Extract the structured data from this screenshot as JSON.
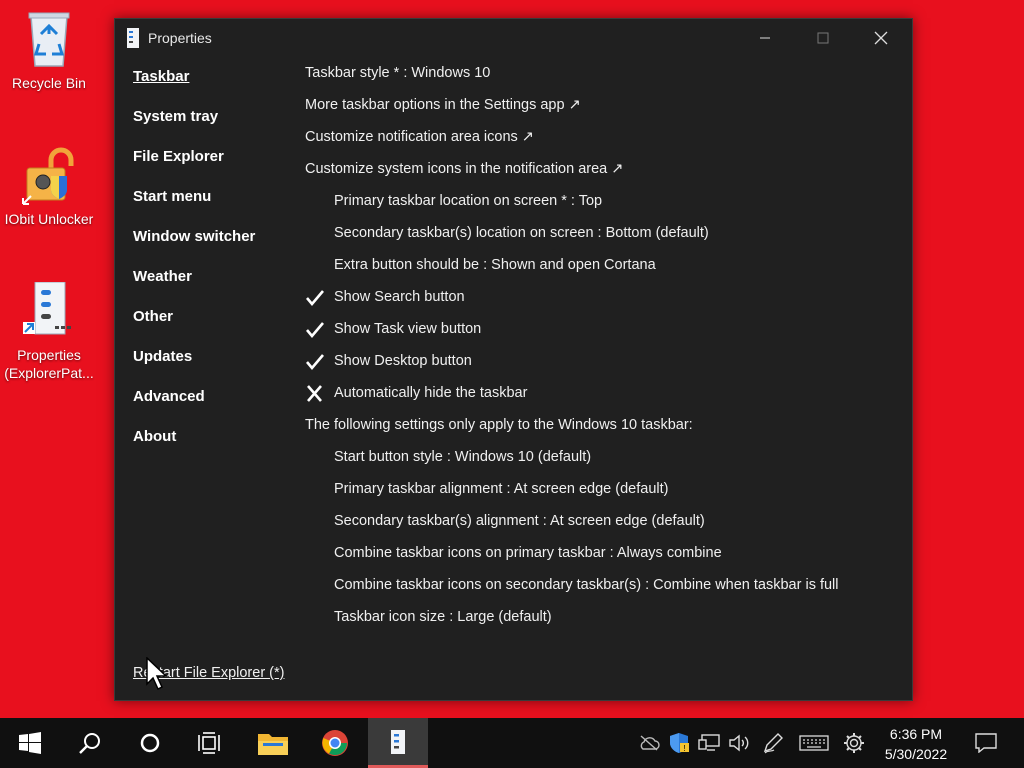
{
  "desktop": {
    "icons": [
      {
        "label": "Recycle Bin"
      },
      {
        "label": "IObit Unlocker"
      },
      {
        "label": "Properties (ExplorerPat..."
      }
    ]
  },
  "window": {
    "title": "Properties",
    "sidebar": [
      {
        "label": "Taskbar",
        "active": true
      },
      {
        "label": "System tray"
      },
      {
        "label": "File Explorer"
      },
      {
        "label": "Start menu"
      },
      {
        "label": "Window switcher"
      },
      {
        "label": "Weather"
      },
      {
        "label": "Other"
      },
      {
        "label": "Updates"
      },
      {
        "label": "Advanced"
      },
      {
        "label": "About"
      }
    ],
    "settings": [
      {
        "text": "Taskbar style * : Windows 10"
      },
      {
        "text": "More taskbar options in the Settings app ↗"
      },
      {
        "text": "Customize notification area icons ↗"
      },
      {
        "text": "Customize system icons in the notification area ↗"
      },
      {
        "text": "Primary taskbar location on screen * : Top"
      },
      {
        "text": "Secondary taskbar(s) location on screen : Bottom (default)"
      },
      {
        "text": "Extra button should be : Shown and open Cortana"
      },
      {
        "text": "Show Search button",
        "state": "checked"
      },
      {
        "text": "Show Task view button",
        "state": "checked"
      },
      {
        "text": "Show Desktop button",
        "state": "checked"
      },
      {
        "text": "Automatically hide the taskbar",
        "state": "unchecked"
      },
      {
        "text": "The following settings only apply to the Windows 10 taskbar:"
      },
      {
        "text": "Start button style : Windows 10 (default)"
      },
      {
        "text": "Primary taskbar alignment : At screen edge (default)"
      },
      {
        "text": "Secondary taskbar(s) alignment : At screen edge (default)"
      },
      {
        "text": "Combine taskbar icons on primary taskbar : Always combine"
      },
      {
        "text": "Combine taskbar icons on secondary taskbar(s) : Combine when taskbar is full"
      },
      {
        "text": "Taskbar icon size : Large (default)"
      }
    ],
    "footer_link": "Restart File Explorer (*)"
  },
  "taskbar": {
    "time": "6:36 PM",
    "date": "5/30/2022"
  },
  "colors": {
    "desktop_bg": "#e8101e",
    "window_bg": "#202020",
    "taskbar_bg": "#101010"
  }
}
